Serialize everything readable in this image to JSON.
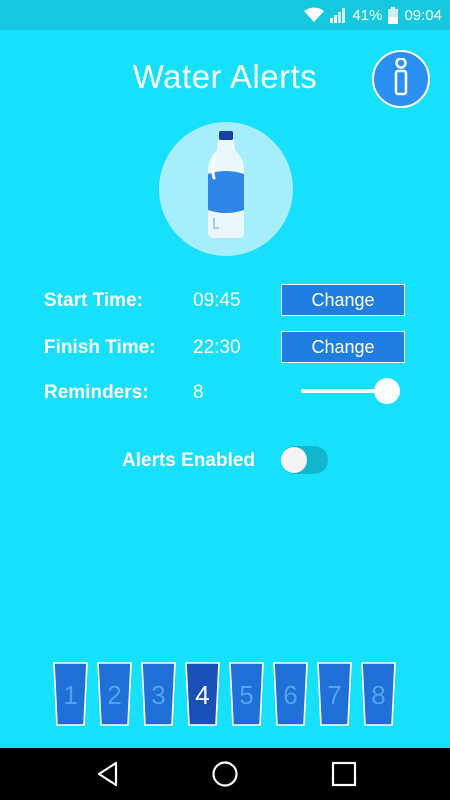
{
  "status_bar": {
    "battery_percent": "41%",
    "time": "09:04",
    "icons": [
      "wifi-icon",
      "signal-icon",
      "battery-icon"
    ]
  },
  "app": {
    "title": "Water Alerts",
    "info_icon": "info-icon",
    "bottle_icon": "water-bottle-icon"
  },
  "settings": {
    "start_time": {
      "label": "Start Time:",
      "value": "09:45",
      "button": "Change"
    },
    "finish_time": {
      "label": "Finish Time:",
      "value": "22:30",
      "button": "Change"
    },
    "reminders": {
      "label": "Reminders:",
      "value": "8",
      "slider_fraction": 1.0
    }
  },
  "alerts": {
    "label": "Alerts Enabled",
    "enabled": false
  },
  "glasses": {
    "items": [
      "1",
      "2",
      "3",
      "4",
      "5",
      "6",
      "7",
      "8"
    ],
    "active_index": 3
  },
  "colors": {
    "background": "#16e0fb",
    "accent_blue": "#1e7fe0",
    "bottle_circle": "#a6eefb"
  },
  "nav_bar": {
    "icons": [
      "back-icon",
      "home-icon",
      "recents-icon"
    ]
  }
}
